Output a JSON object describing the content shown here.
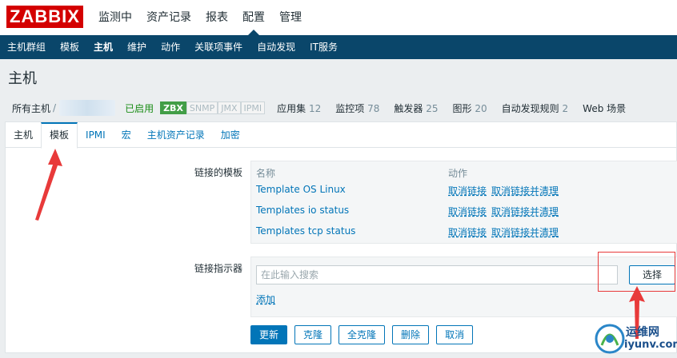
{
  "logo": "ZABBIX",
  "top_menu": [
    "监测中",
    "资产记录",
    "报表",
    "配置",
    "管理"
  ],
  "sub_menu": [
    "主机群组",
    "模板",
    "主机",
    "维护",
    "动作",
    "关联项事件",
    "自动发现",
    "IT服务"
  ],
  "page_title": "主机",
  "breadcrumb": {
    "all_hosts": "所有主机",
    "sep": "/",
    "status": "已启用",
    "availability": [
      "ZBX",
      "SNMP",
      "JMX",
      "IPMI"
    ],
    "links": [
      {
        "label": "应用集",
        "count": "12"
      },
      {
        "label": "监控项",
        "count": "78"
      },
      {
        "label": "触发器",
        "count": "25"
      },
      {
        "label": "图形",
        "count": "20"
      },
      {
        "label": "自动发现规则",
        "count": "2"
      },
      {
        "label": "Web 场景",
        "count": ""
      }
    ]
  },
  "tabs": [
    "主机",
    "模板",
    "IPMI",
    "宏",
    "主机资产记录",
    "加密"
  ],
  "form": {
    "linked_label": "链接的模板",
    "col_name": "名称",
    "col_action": "动作",
    "templates": [
      {
        "name": "Template OS Linux",
        "unlink": "取消链接",
        "unlink_clear": "取消链接并清理"
      },
      {
        "name": "Templates io status",
        "unlink": "取消链接",
        "unlink_clear": "取消链接并清理"
      },
      {
        "name": "Templates tcp status",
        "unlink": "取消链接",
        "unlink_clear": "取消链接并清理"
      }
    ],
    "link_indicator_label": "链接指示器",
    "search_placeholder": "在此输入搜索",
    "select_label": "选择",
    "add_label": "添加"
  },
  "buttons": {
    "update": "更新",
    "clone": "克隆",
    "full_clone": "全克隆",
    "delete": "删除",
    "cancel": "取消"
  },
  "watermark": {
    "line1": "运维网",
    "line2": "iyunv.com"
  },
  "colors": {
    "brand": "#d40000",
    "nav": "#0a466a",
    "link": "#0275b8",
    "annotation": "#e83a3a"
  }
}
